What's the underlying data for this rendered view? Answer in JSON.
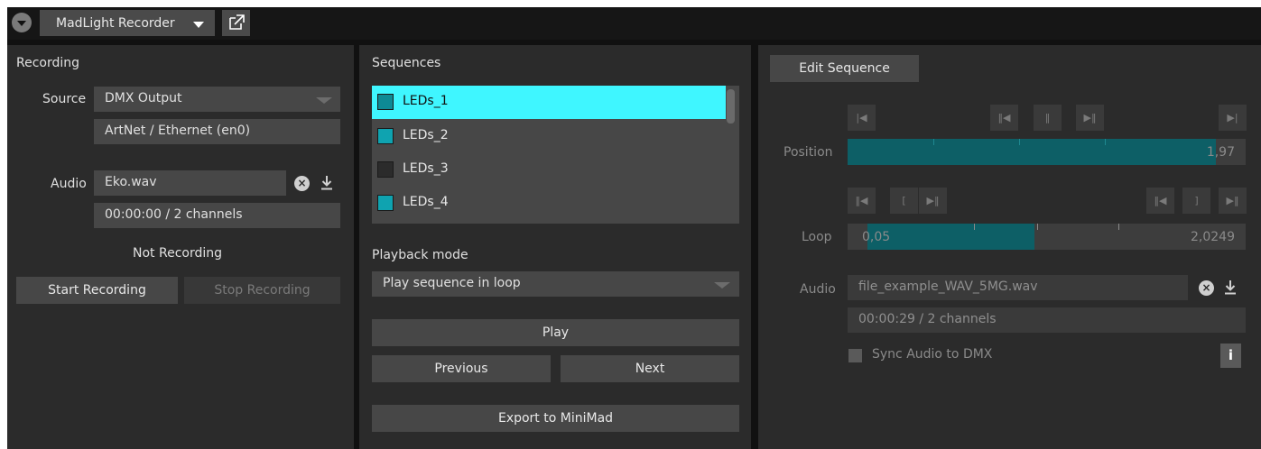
{
  "topbar": {
    "app_name": "MadLight Recorder"
  },
  "recording": {
    "title": "Recording",
    "source_label": "Source",
    "source_value": "DMX Output",
    "source_detail": "ArtNet / Ethernet (en0)",
    "audio_label": "Audio",
    "audio_file": "Eko.wav",
    "audio_info": "00:00:00 / 2 channels",
    "status": "Not Recording",
    "start_button": "Start Recording",
    "stop_button": "Stop Recording"
  },
  "sequences": {
    "title": "Sequences",
    "items": [
      {
        "label": "LEDs_1",
        "color": "#0e8a95",
        "selected": true
      },
      {
        "label": "LEDs_2",
        "color": "#0fa3b0",
        "selected": false
      },
      {
        "label": "LEDs_3",
        "color": "#2b2b2b",
        "selected": false
      },
      {
        "label": "LEDs_4",
        "color": "#0fa3b0",
        "selected": false
      }
    ],
    "playback_label": "Playback mode",
    "playback_value": "Play sequence in loop",
    "play_button": "Play",
    "previous_button": "Previous",
    "next_button": "Next",
    "export_button": "Export to MiniMad"
  },
  "editor": {
    "edit_button": "Edit Sequence",
    "position_label": "Position",
    "position_value": "1,97",
    "position_progress": 0.925,
    "loop_label": "Loop",
    "loop_start": "0,05",
    "loop_end": "2,0249",
    "loop_range": [
      0.05,
      0.47
    ],
    "audio_label": "Audio",
    "audio_file": "file_example_WAV_5MG.wav",
    "audio_info": "00:00:29 / 2 channels",
    "sync_label": "Sync Audio to DMX",
    "sync_checked": false,
    "info_label": "i",
    "transport_glyphs": {
      "to_start": "|◀",
      "prev": "‖◀",
      "pause": "‖",
      "play_next": "▶‖",
      "to_end": "▶|",
      "loop_in": "[",
      "loop_out": "]"
    }
  },
  "colors": {
    "accent": "#3ff6ff",
    "track_fill": "#0d5f66",
    "panel": "#2b2b2b"
  }
}
